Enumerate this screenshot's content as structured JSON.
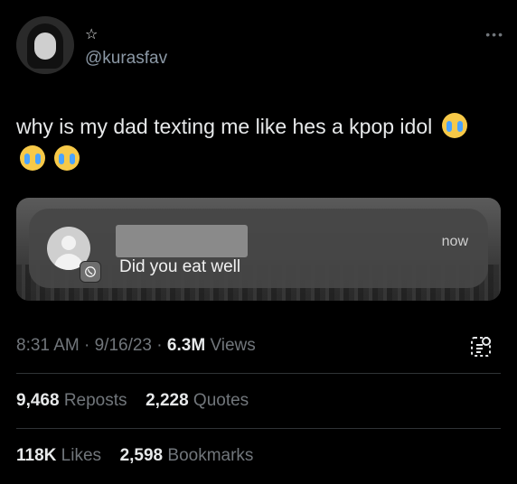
{
  "tweet": {
    "handle": "@kurasfav",
    "star": "☆",
    "more": "•••",
    "text": "why is my dad texting me like hes a kpop idol",
    "emojis": [
      "loudly-crying-face",
      "loudly-crying-face",
      "loudly-crying-face"
    ]
  },
  "notification": {
    "message": "Did you eat well",
    "time": "now",
    "app_badge": "whatsapp-icon"
  },
  "meta": {
    "time": "8:31 AM",
    "date": "9/16/23",
    "views_count": "6.3M",
    "views_label": "Views"
  },
  "stats": {
    "reposts_count": "9,468",
    "reposts_label": "Reposts",
    "quotes_count": "2,228",
    "quotes_label": "Quotes",
    "likes_count": "118K",
    "likes_label": "Likes",
    "bookmarks_count": "2,598",
    "bookmarks_label": "Bookmarks"
  }
}
